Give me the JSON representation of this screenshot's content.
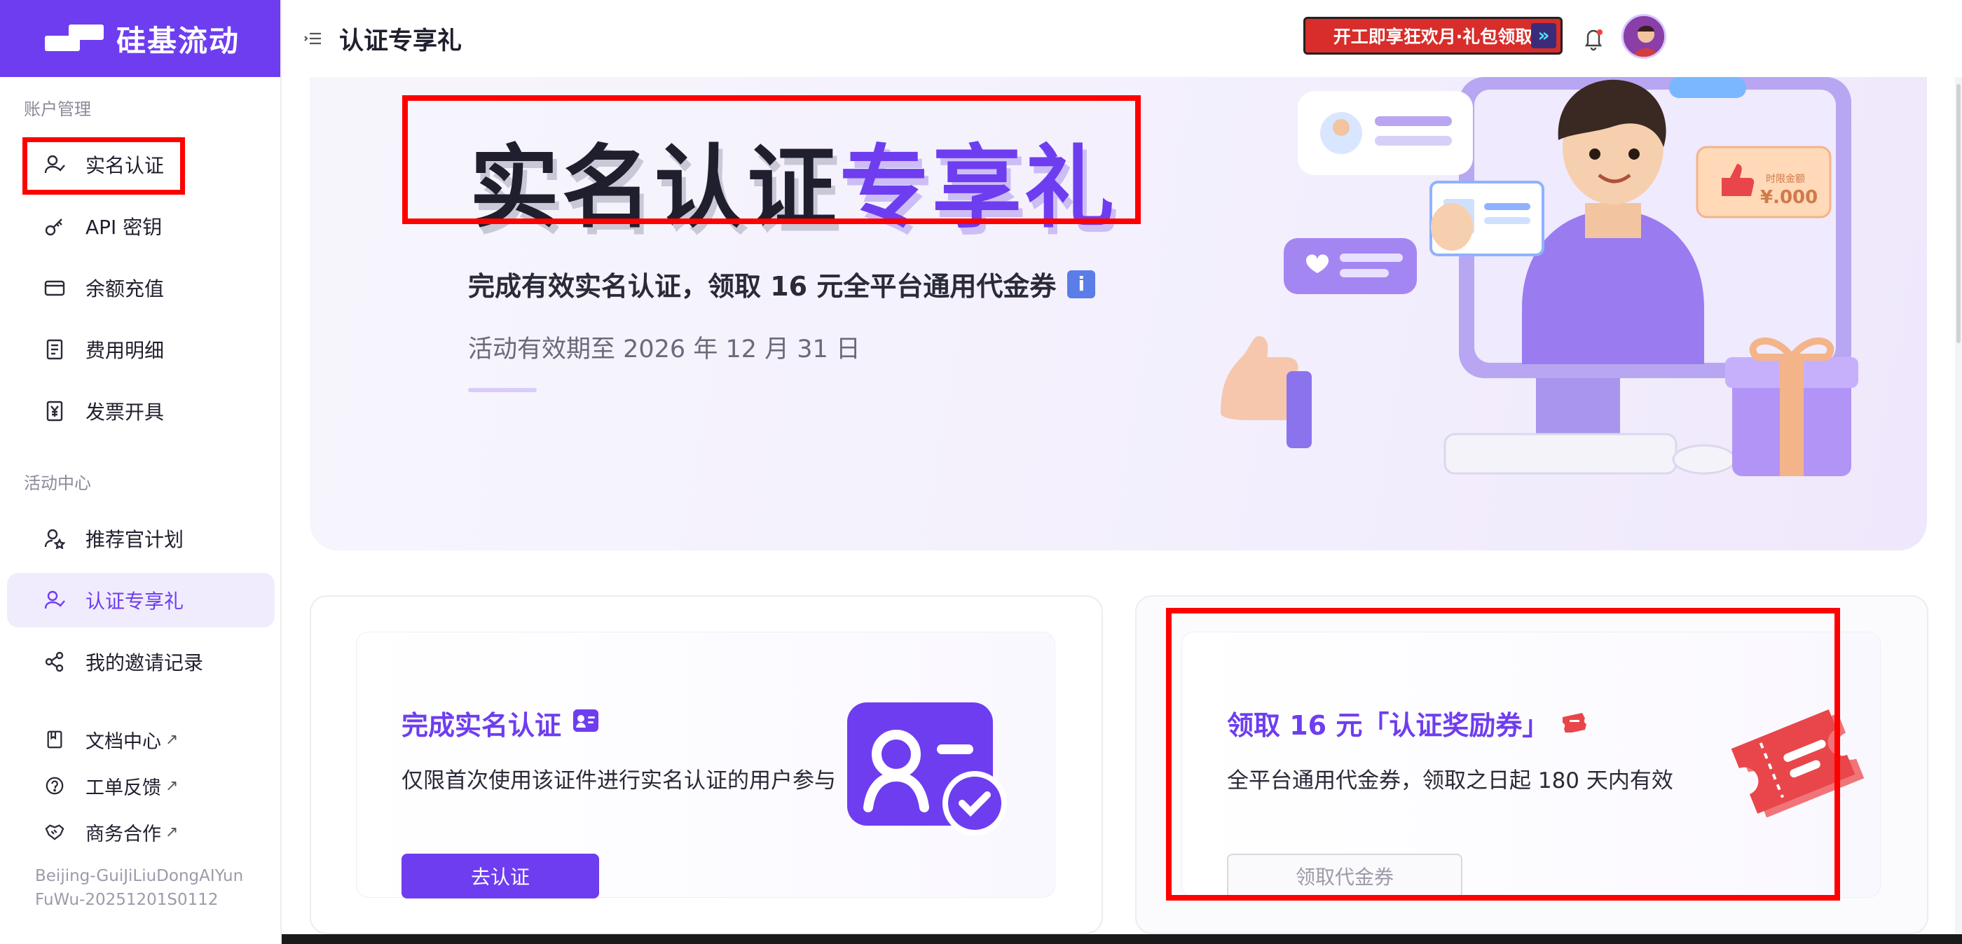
{
  "brand": {
    "name": "硅基流动"
  },
  "header": {
    "title": "认证专享礼",
    "promo_text": "开工即享狂欢月·礼包领取"
  },
  "sidebar": {
    "sections": [
      {
        "label": "账户管理"
      },
      {
        "label": "活动中心"
      }
    ],
    "items": [
      {
        "label": "实名认证",
        "icon": "user-check-icon"
      },
      {
        "label": "API 密钥",
        "icon": "key-icon"
      },
      {
        "label": "余额充值",
        "icon": "credit-card-icon"
      },
      {
        "label": "费用明细",
        "icon": "receipt-icon"
      },
      {
        "label": "发票开具",
        "icon": "invoice-yuan-icon"
      },
      {
        "label": "推荐官计划",
        "icon": "user-star-icon"
      },
      {
        "label": "认证专享礼",
        "icon": "user-check-icon"
      },
      {
        "label": "我的邀请记录",
        "icon": "share-icon"
      },
      {
        "label": "文档中心",
        "icon": "book-icon"
      },
      {
        "label": "工单反馈",
        "icon": "help-circle-icon"
      },
      {
        "label": "商务合作",
        "icon": "handshake-icon"
      }
    ],
    "external_arrow": "↗",
    "build_line1": "Beijing-GuiJiLiuDongAIYun",
    "build_line2": "FuWu-20251201S0112"
  },
  "hero": {
    "title_part1": "实名认证",
    "title_part2": "专享礼",
    "subtitle": "完成有效实名认证，领取 16 元全平台通用代金券",
    "info_glyph": "i",
    "date": "活动有效期至 2026 年 12 月 31 日",
    "coupon_text": "¥.000"
  },
  "cards": [
    {
      "title": "完成实名认证",
      "desc": "仅限首次使用该证件进行实名认证的用户参与",
      "button": "去认证"
    },
    {
      "title": "领取 16 元「认证奖励券」",
      "desc": "全平台通用代金券，领取之日起 180 天内有效",
      "button": "领取代金券"
    }
  ],
  "colors": {
    "accent": "#6e3df0",
    "highlight": "#ff0000",
    "coupon": "#e8464a"
  }
}
